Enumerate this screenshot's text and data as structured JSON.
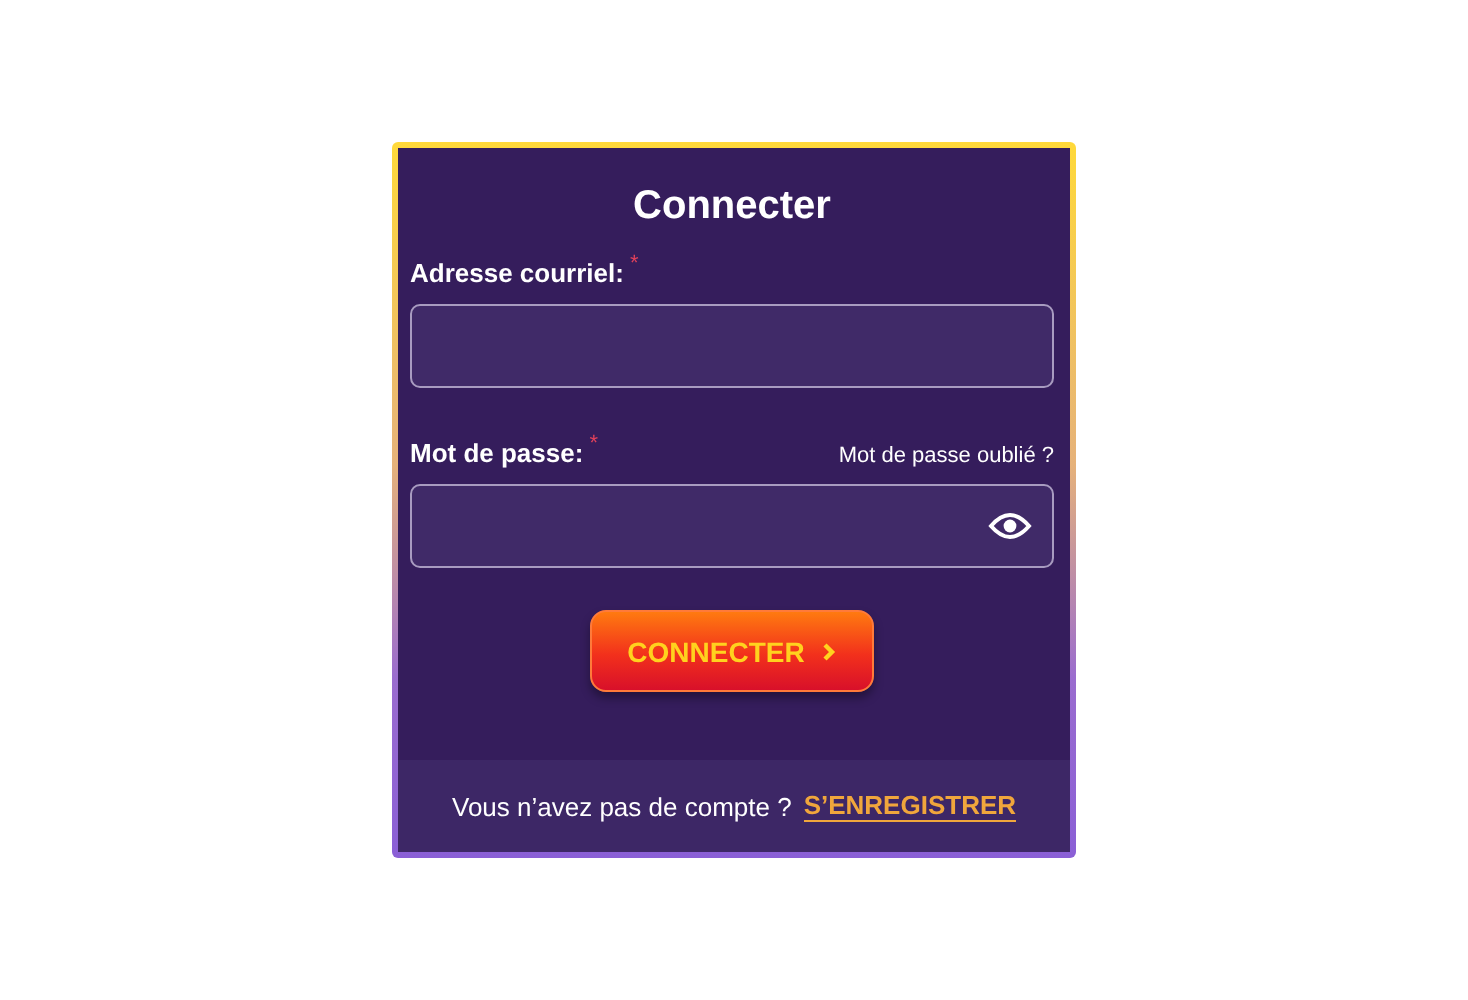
{
  "title": "Connecter",
  "fields": [
    {
      "kind": "email",
      "label": "Adresse courriel:",
      "required_mark": "*"
    },
    {
      "kind": "password",
      "label": "Mot de passe:",
      "required_mark": "*",
      "link": "Mot de passe oublié ?"
    }
  ],
  "submit": {
    "label": "CONNECTER"
  },
  "footer": {
    "text": "Vous n’avez pas de compte ?",
    "link": "S’ENREGISTRER"
  }
}
